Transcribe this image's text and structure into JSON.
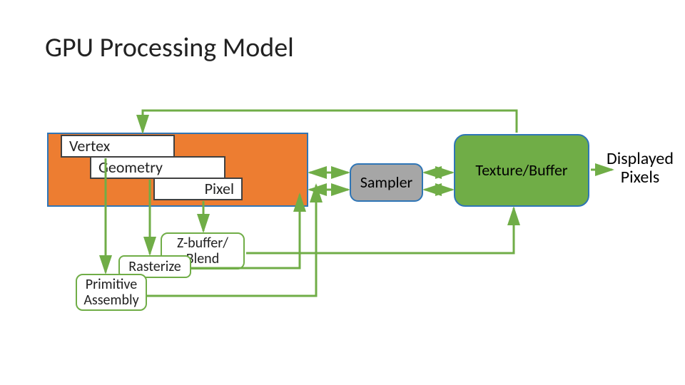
{
  "title": "GPU Processing Model",
  "stages": {
    "vertex": "Vertex",
    "geometry": "Geometry",
    "pixel": "Pixel"
  },
  "fixed": {
    "zbuffer": "Z-buffer/\nBlend",
    "rasterize": "Rasterize",
    "primitive": "Primitive\nAssembly"
  },
  "sampler": "Sampler",
  "texture_buffer": "Texture/Buffer",
  "display": "Displayed\nPixels",
  "chart_data": {
    "type": "diagram",
    "title": "GPU Processing Model",
    "nodes": [
      {
        "id": "unified",
        "label": "",
        "kind": "group",
        "contains": [
          "vertex",
          "geometry",
          "pixel"
        ]
      },
      {
        "id": "vertex",
        "label": "Vertex",
        "kind": "shader"
      },
      {
        "id": "geometry",
        "label": "Geometry",
        "kind": "shader"
      },
      {
        "id": "pixel",
        "label": "Pixel",
        "kind": "shader"
      },
      {
        "id": "zbuffer",
        "label": "Z-buffer/ Blend",
        "kind": "fixed"
      },
      {
        "id": "rasterize",
        "label": "Rasterize",
        "kind": "fixed"
      },
      {
        "id": "primitive",
        "label": "Primitive Assembly",
        "kind": "fixed"
      },
      {
        "id": "sampler",
        "label": "Sampler",
        "kind": "unit"
      },
      {
        "id": "texture_buffer",
        "label": "Texture/Buffer",
        "kind": "memory"
      },
      {
        "id": "display",
        "label": "Displayed Pixels",
        "kind": "output"
      }
    ],
    "edges": [
      {
        "from": "vertex",
        "to": "primitive"
      },
      {
        "from": "geometry",
        "to": "rasterize"
      },
      {
        "from": "pixel",
        "to": "zbuffer"
      },
      {
        "from": "primitive",
        "to": "unified",
        "note": "back to pool"
      },
      {
        "from": "rasterize",
        "to": "unified",
        "note": "back to pool"
      },
      {
        "from": "zbuffer",
        "to": "texture_buffer"
      },
      {
        "from": "unified",
        "to": "sampler",
        "bidirectional": true
      },
      {
        "from": "sampler",
        "to": "texture_buffer",
        "bidirectional": true
      },
      {
        "from": "texture_buffer",
        "to": "unified",
        "note": "feedback top"
      },
      {
        "from": "texture_buffer",
        "to": "display"
      }
    ]
  }
}
